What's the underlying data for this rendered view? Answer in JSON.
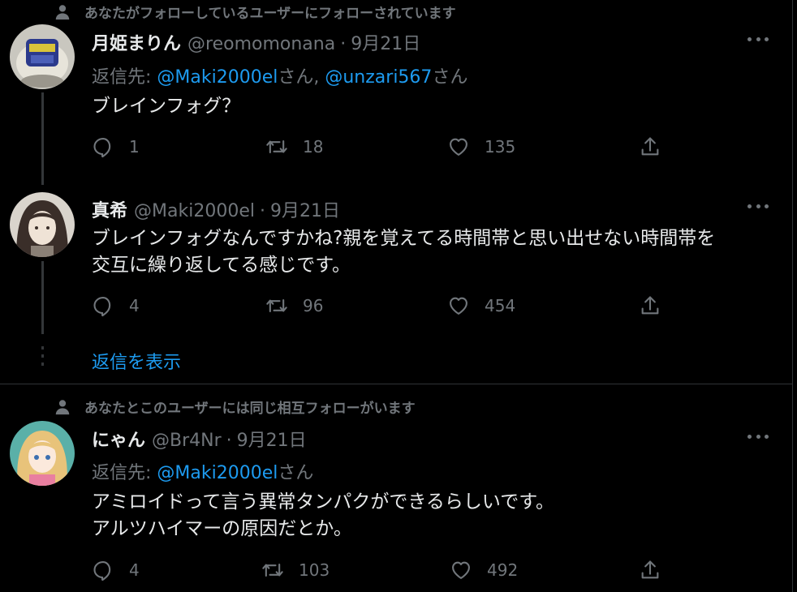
{
  "tweets": [
    {
      "social": "あなたがフォローしているユーザーにフォローされています",
      "name": "月姫まりん",
      "handle": "@reomomonana",
      "sep": "·",
      "date": "9月21日",
      "reply_prefix": "返信先: ",
      "mentions": [
        {
          "handle": "@Maki2000el",
          "suffix": "さん, "
        },
        {
          "handle": "@unzari567",
          "suffix": "さん"
        }
      ],
      "text": "ブレインフォグ？",
      "counts": {
        "reply": "1",
        "retweet": "18",
        "like": "135"
      }
    },
    {
      "name": "真希",
      "handle": "@Maki2000el",
      "sep": "·",
      "date": "9月21日",
      "text_lines": [
        "ブレインフォグなんですかね?親を覚えてる時間帯と思い出せない時間帯を",
        "交互に繰り返してる感じです。"
      ],
      "counts": {
        "reply": "4",
        "retweet": "96",
        "like": "454"
      }
    },
    {
      "social": "あなたとこのユーザーには同じ相互フォローがいます",
      "name": "にゃん",
      "handle": "@Br4Nr",
      "sep": "·",
      "date": "9月21日",
      "reply_prefix": "返信先: ",
      "mentions": [
        {
          "handle": "@Maki2000el",
          "suffix": "さん"
        }
      ],
      "text_lines": [
        "アミロイドって言う異常タンパクができるらしいです。",
        "アルツハイマーの原因だとか。"
      ],
      "counts": {
        "reply": "4",
        "retweet": "103",
        "like": "492"
      }
    }
  ],
  "show_replies": "返信を表示",
  "colors": {
    "background": "#000000",
    "accent": "#1d9bf0",
    "muted": "#71767b",
    "text": "#e7e9ea",
    "border": "#2f3336"
  },
  "icons": [
    "person-icon",
    "reply-icon",
    "retweet-icon",
    "like-icon",
    "share-icon",
    "more-icon"
  ]
}
